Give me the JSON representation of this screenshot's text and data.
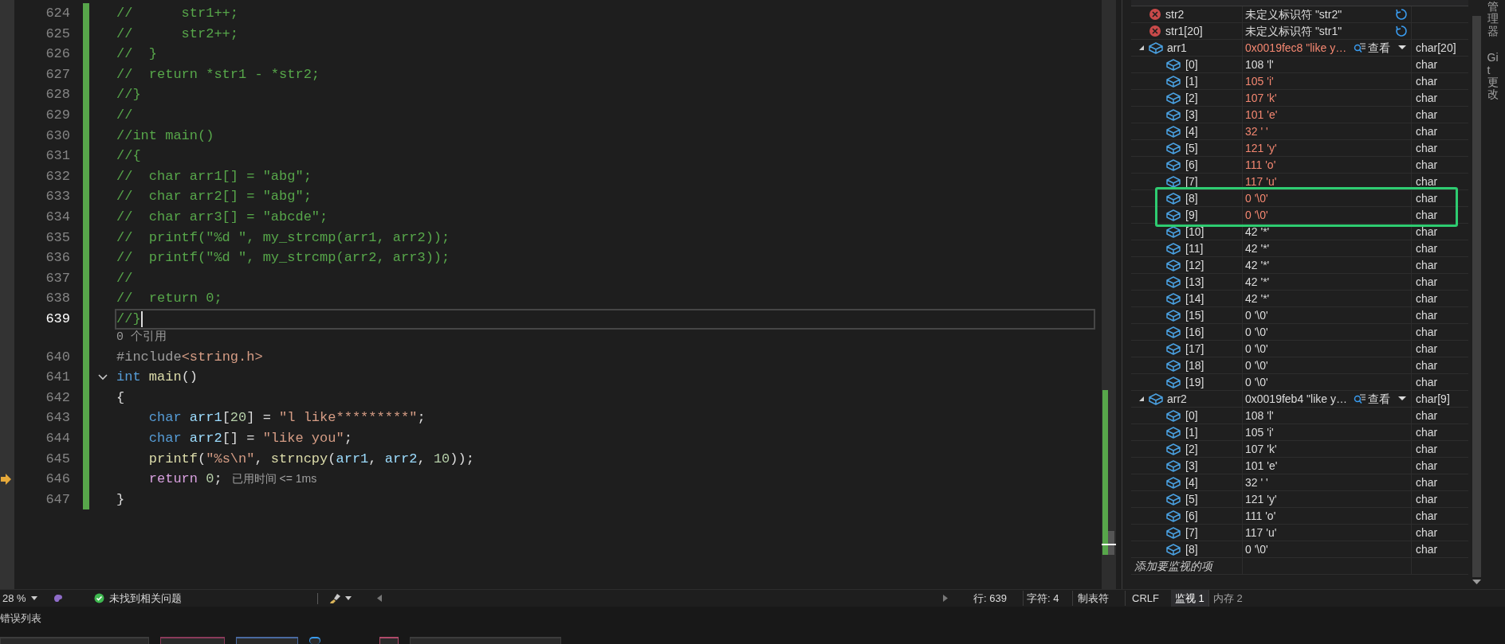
{
  "editor": {
    "lines": [
      {
        "number": "624",
        "tokens": [
          {
            "kind": "comment",
            "text": "//      str1++;"
          }
        ]
      },
      {
        "number": "625",
        "tokens": [
          {
            "kind": "comment",
            "text": "//      str2++;"
          }
        ]
      },
      {
        "number": "626",
        "tokens": [
          {
            "kind": "comment",
            "text": "//  }"
          }
        ]
      },
      {
        "number": "627",
        "tokens": [
          {
            "kind": "comment",
            "text": "//  return *str1 - *str2;"
          }
        ]
      },
      {
        "number": "628",
        "tokens": [
          {
            "kind": "comment",
            "text": "//}"
          }
        ]
      },
      {
        "number": "629",
        "tokens": [
          {
            "kind": "comment",
            "text": "//"
          }
        ]
      },
      {
        "number": "630",
        "tokens": [
          {
            "kind": "comment",
            "text": "//int main()"
          }
        ]
      },
      {
        "number": "631",
        "tokens": [
          {
            "kind": "comment",
            "text": "//{"
          }
        ]
      },
      {
        "number": "632",
        "tokens": [
          {
            "kind": "comment",
            "text": "//  char arr1[] = \"abg\";"
          }
        ]
      },
      {
        "number": "633",
        "tokens": [
          {
            "kind": "comment",
            "text": "//  char arr2[] = \"abg\";"
          }
        ]
      },
      {
        "number": "634",
        "tokens": [
          {
            "kind": "comment",
            "text": "//  char arr3[] = \"abcde\";"
          }
        ]
      },
      {
        "number": "635",
        "tokens": [
          {
            "kind": "comment",
            "text": "//  printf(\"%d \", my_strcmp(arr1, arr2));"
          }
        ]
      },
      {
        "number": "636",
        "tokens": [
          {
            "kind": "comment",
            "text": "//  printf(\"%d \", my_strcmp(arr2, arr3));"
          }
        ]
      },
      {
        "number": "637",
        "tokens": [
          {
            "kind": "comment",
            "text": "//"
          }
        ]
      },
      {
        "number": "638",
        "tokens": [
          {
            "kind": "comment",
            "text": "//  return 0;"
          }
        ]
      },
      {
        "number": "639",
        "current": true,
        "tokens": [
          {
            "kind": "comment",
            "text": "//}"
          }
        ]
      },
      {
        "kind": "codelens",
        "text": "0 个引用"
      },
      {
        "number": "640",
        "tokens": [
          {
            "kind": "preproc",
            "text": "#include"
          },
          {
            "kind": "string",
            "text": "<string.h>"
          }
        ]
      },
      {
        "number": "641",
        "expanded": true,
        "tokens": [
          {
            "kind": "keyword",
            "text": "int"
          },
          {
            "kind": "func",
            "text": " main"
          },
          {
            "kind": "plain",
            "text": "()"
          }
        ]
      },
      {
        "number": "642",
        "tokens": [
          {
            "kind": "plain",
            "text": "{"
          }
        ]
      },
      {
        "number": "643",
        "tokens": [
          {
            "kind": "keyword",
            "text": "    char"
          },
          {
            "kind": "var",
            "text": " arr1"
          },
          {
            "kind": "plain",
            "text": "["
          },
          {
            "kind": "number",
            "text": "20"
          },
          {
            "kind": "plain",
            "text": "] = "
          },
          {
            "kind": "string",
            "text": "\"l like*********\""
          },
          {
            "kind": "plain",
            "text": ";"
          }
        ]
      },
      {
        "number": "644",
        "tokens": [
          {
            "kind": "keyword",
            "text": "    char"
          },
          {
            "kind": "var",
            "text": " arr2"
          },
          {
            "kind": "plain",
            "text": "[] = "
          },
          {
            "kind": "string",
            "text": "\"like you\""
          },
          {
            "kind": "plain",
            "text": ";"
          }
        ]
      },
      {
        "number": "645",
        "tokens": [
          {
            "kind": "func",
            "text": "    printf"
          },
          {
            "kind": "plain",
            "text": "("
          },
          {
            "kind": "string",
            "text": "\"%s\\n\""
          },
          {
            "kind": "plain",
            "text": ", "
          },
          {
            "kind": "func",
            "text": "strncpy"
          },
          {
            "kind": "plain",
            "text": "("
          },
          {
            "kind": "var",
            "text": "arr1"
          },
          {
            "kind": "plain",
            "text": ", "
          },
          {
            "kind": "var",
            "text": "arr2"
          },
          {
            "kind": "plain",
            "text": ", "
          },
          {
            "kind": "number",
            "text": "10"
          },
          {
            "kind": "plain",
            "text": "));"
          }
        ]
      },
      {
        "number": "646",
        "execution_point": true,
        "tokens": [
          {
            "kind": "control",
            "text": "    return"
          },
          {
            "kind": "number",
            "text": " 0"
          },
          {
            "kind": "plain",
            "text": ";"
          },
          {
            "kind": "hint",
            "text": "已用时间 <= 1ms"
          }
        ]
      },
      {
        "number": "647",
        "tokens": [
          {
            "kind": "plain",
            "text": "}"
          }
        ]
      }
    ]
  },
  "watch": {
    "rows": [
      {
        "kind": "error",
        "name": "str2",
        "value": "未定义标识符 \"str2\""
      },
      {
        "kind": "error",
        "name": "str1[20]",
        "value": "未定义标识符 \"str1\""
      },
      {
        "kind": "array",
        "name": "arr1",
        "value": "0x0019fec8 \"like y…",
        "changed": true,
        "view_label": "查看",
        "type": "char[20]",
        "expanded": true,
        "children": [
          {
            "name": "[0]",
            "value": "108 'l'",
            "changed": false,
            "type": "char",
            "highlighted": false
          },
          {
            "name": "[1]",
            "value": "105 'i'",
            "changed": true,
            "type": "char",
            "highlighted": false
          },
          {
            "name": "[2]",
            "value": "107 'k'",
            "changed": true,
            "type": "char",
            "highlighted": false
          },
          {
            "name": "[3]",
            "value": "101 'e'",
            "changed": true,
            "type": "char",
            "highlighted": false
          },
          {
            "name": "[4]",
            "value": "32 ' '",
            "changed": true,
            "type": "char",
            "highlighted": false
          },
          {
            "name": "[5]",
            "value": "121 'y'",
            "changed": true,
            "type": "char",
            "highlighted": false
          },
          {
            "name": "[6]",
            "value": "111 'o'",
            "changed": true,
            "type": "char",
            "highlighted": false
          },
          {
            "name": "[7]",
            "value": "117 'u'",
            "changed": true,
            "type": "char",
            "highlighted": false
          },
          {
            "name": "[8]",
            "value": "0 '\\0'",
            "changed": true,
            "type": "char",
            "highlighted": true
          },
          {
            "name": "[9]",
            "value": "0 '\\0'",
            "changed": true,
            "type": "char",
            "highlighted": true
          },
          {
            "name": "[10]",
            "value": "42 '*'",
            "changed": false,
            "type": "char",
            "highlighted": false
          },
          {
            "name": "[11]",
            "value": "42 '*'",
            "changed": false,
            "type": "char",
            "highlighted": false
          },
          {
            "name": "[12]",
            "value": "42 '*'",
            "changed": false,
            "type": "char",
            "highlighted": false
          },
          {
            "name": "[13]",
            "value": "42 '*'",
            "changed": false,
            "type": "char",
            "highlighted": false
          },
          {
            "name": "[14]",
            "value": "42 '*'",
            "changed": false,
            "type": "char",
            "highlighted": false
          },
          {
            "name": "[15]",
            "value": "0 '\\0'",
            "changed": false,
            "type": "char",
            "highlighted": false
          },
          {
            "name": "[16]",
            "value": "0 '\\0'",
            "changed": false,
            "type": "char",
            "highlighted": false
          },
          {
            "name": "[17]",
            "value": "0 '\\0'",
            "changed": false,
            "type": "char",
            "highlighted": false
          },
          {
            "name": "[18]",
            "value": "0 '\\0'",
            "changed": false,
            "type": "char",
            "highlighted": false
          },
          {
            "name": "[19]",
            "value": "0 '\\0'",
            "changed": false,
            "type": "char",
            "highlighted": false
          }
        ]
      },
      {
        "kind": "array",
        "name": "arr2",
        "value": "0x0019feb4 \"like y…",
        "changed": false,
        "view_label": "查看",
        "type": "char[9]",
        "expanded": true,
        "children": [
          {
            "name": "[0]",
            "value": "108 'l'",
            "changed": false,
            "type": "char",
            "highlighted": false
          },
          {
            "name": "[1]",
            "value": "105 'i'",
            "changed": false,
            "type": "char",
            "highlighted": false
          },
          {
            "name": "[2]",
            "value": "107 'k'",
            "changed": false,
            "type": "char",
            "highlighted": false
          },
          {
            "name": "[3]",
            "value": "101 'e'",
            "changed": false,
            "type": "char",
            "highlighted": false
          },
          {
            "name": "[4]",
            "value": "32 ' '",
            "changed": false,
            "type": "char",
            "highlighted": false
          },
          {
            "name": "[5]",
            "value": "121 'y'",
            "changed": false,
            "type": "char",
            "highlighted": false
          },
          {
            "name": "[6]",
            "value": "111 'o'",
            "changed": false,
            "type": "char",
            "highlighted": false
          },
          {
            "name": "[7]",
            "value": "117 'u'",
            "changed": false,
            "type": "char",
            "highlighted": false
          },
          {
            "name": "[8]",
            "value": "0 '\\0'",
            "changed": false,
            "type": "char",
            "highlighted": false
          }
        ]
      },
      {
        "kind": "add",
        "name": "添加要监视的项"
      }
    ],
    "tabs": [
      {
        "label": "监视 1",
        "selected": true
      },
      {
        "label": "内存 2",
        "selected": false
      }
    ]
  },
  "side_tabs": [
    "管理器",
    "Git 更改"
  ],
  "status_bar": {
    "zoom": "28 %",
    "issues": "未找到相关问题",
    "line": "行: 639",
    "column": "字符: 4",
    "indent": "制表符",
    "line_ending": "CRLF"
  },
  "bottom_panel": {
    "title": "错误列表"
  }
}
